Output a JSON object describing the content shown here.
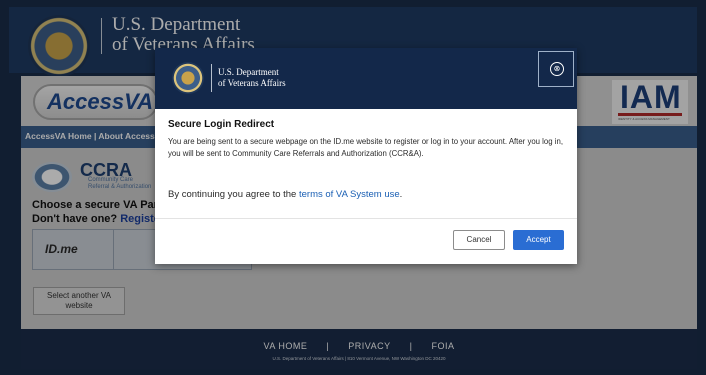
{
  "background": {
    "header_title_line1": "U.S. Department",
    "header_title_line2": "of Veterans Affairs",
    "accessva_logo": "AccessVA",
    "iam_logo": "IAM",
    "iam_subtitle": "IDENTITY & ACCESS MANAGEMENT",
    "nav_text": "AccessVA Home | About AccessVA",
    "ccra_title": "CCRA",
    "ccra_sub1": "Community Care",
    "ccra_sub2": "Referral & Authorization",
    "choose_text": "Choose a secure VA Partner",
    "dont_have": "Don't have one? ",
    "register_link": "Register t",
    "idme_label": "ID.me",
    "select_another": "Select another VA website",
    "footer_link_home": "VA HOME",
    "footer_link_privacy": "PRIVACY",
    "footer_link_foia": "FOIA",
    "footer_sep": "|",
    "footer_address": "U.S. Department of Veterans Affairs | 810 Vermont Avenue, NW Washington DC 20420"
  },
  "modal": {
    "header_line1": "U.S. Department",
    "header_line2": "of Veterans Affairs",
    "close_icon": "⊗",
    "heading": "Secure Login Redirect",
    "body": "You are being sent to a secure webpage on the ID.me website to register or log in to your account. After you log in, you will be sent to Community Care Referrals and Authorization (CCR&A).",
    "agree_prefix": "By continuing you agree to the ",
    "terms_link": "terms of VA System use",
    "agree_suffix": ".",
    "cancel_label": "Cancel",
    "accept_label": "Accept"
  },
  "colors": {
    "header_navy": "#13284a",
    "accept_blue": "#2a6dd3",
    "link_blue": "#1a5fb4"
  }
}
